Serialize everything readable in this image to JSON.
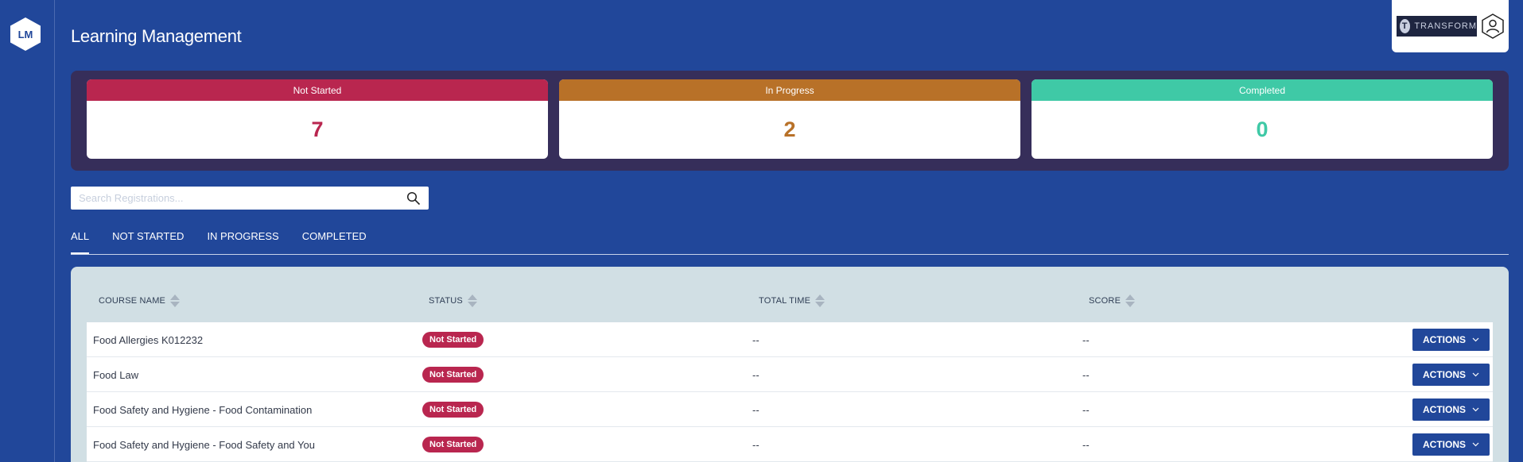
{
  "sidebar": {
    "logo_text": "LM"
  },
  "header": {
    "title": "Learning Management"
  },
  "brand": {
    "name": "TRANSFORM",
    "initial": "T",
    "user_icon": "user-icon"
  },
  "stats": [
    {
      "label": "Not Started",
      "value": "7",
      "color": "#b9264f"
    },
    {
      "label": "In Progress",
      "value": "2",
      "color": "#b87128"
    },
    {
      "label": "Completed",
      "value": "0",
      "color": "#3fc9a6"
    }
  ],
  "search": {
    "placeholder": "Search Registrations...",
    "value": "",
    "icon": "search-icon"
  },
  "tabs": [
    {
      "label": "ALL",
      "active": true
    },
    {
      "label": "NOT STARTED",
      "active": false
    },
    {
      "label": "IN PROGRESS",
      "active": false
    },
    {
      "label": "COMPLETED",
      "active": false
    }
  ],
  "table": {
    "columns": [
      "COURSE NAME",
      "STATUS",
      "TOTAL TIME",
      "SCORE"
    ],
    "rows": [
      {
        "course": "Food Allergies K012232",
        "status": "Not Started",
        "time": "--",
        "score": "--",
        "action": "ACTIONS"
      },
      {
        "course": "Food Law",
        "status": "Not Started",
        "time": "--",
        "score": "--",
        "action": "ACTIONS"
      },
      {
        "course": "Food Safety and Hygiene - Food Contamination",
        "status": "Not Started",
        "time": "--",
        "score": "--",
        "action": "ACTIONS"
      },
      {
        "course": "Food Safety and Hygiene - Food Safety and You",
        "status": "Not Started",
        "time": "--",
        "score": "--",
        "action": "ACTIONS"
      }
    ]
  }
}
